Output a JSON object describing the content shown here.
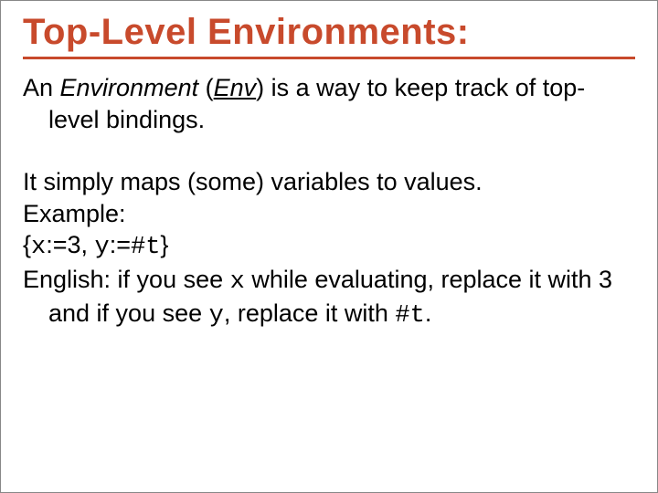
{
  "title": "Top-Level Environments:",
  "p1_a": "An ",
  "p1_b": "Environment",
  "p1_c": " (",
  "p1_d": "Env",
  "p1_e": ") is a way to keep track of top-level bindings.",
  "p2": "It simply maps (some) variables to values.",
  "p3": "Example:",
  "p4_a": "{",
  "p4_b": "x",
  "p4_c": ":=3, ",
  "p4_d": "y",
  "p4_e": ":=",
  "p4_f": "#t",
  "p4_g": "}",
  "p5_a": "English:  if you see ",
  "p5_b": "x",
  "p5_c": " while evaluating, replace it with 3 and if you see ",
  "p5_d": "y",
  "p5_e": ", replace it with ",
  "p5_f": "#t",
  "p5_g": "."
}
